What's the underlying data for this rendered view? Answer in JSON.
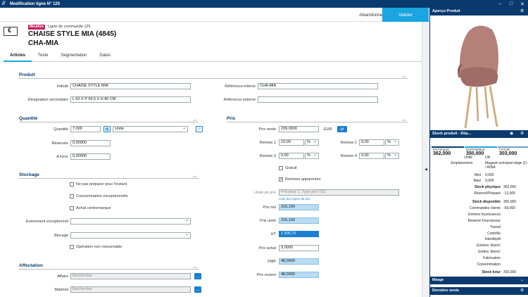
{
  "window": {
    "logo": "//",
    "title": "Modification ligne N° 125"
  },
  "toolbar": {
    "cancel": "Abandonner",
    "validate": "Valider"
  },
  "header": {
    "badge": "Meubles",
    "subtitle": "Ligne de commande 125",
    "name": "CHAISE STYLE MIA (4845)",
    "code": "CHA-MIA"
  },
  "tabs": [
    "Articles",
    "Texte",
    "Segmentation",
    "Dates"
  ],
  "produit": {
    "title": "Produit",
    "intitule_label": "Intitulé",
    "intitule": "CHAISE STYLE MIA",
    "designation_label": "Désignation secondaire",
    "designation": "L 62 X P 59,5 X H 86 CM",
    "ref_interne_label": "Référence interne",
    "ref_interne": "CHA-MIA",
    "ref_externe_label": "Référence externe",
    "ref_externe": ""
  },
  "quantite": {
    "title": "Quantité",
    "quantite_label": "Quantité",
    "quantite": "7,000",
    "unite": "Unité",
    "reservee_label": "Réservée",
    "reservee": "0,00000",
    "alivrer_label": "A livrer",
    "alivrer": "0,00000"
  },
  "stockage": {
    "title": "Stockage",
    "cb1": "Ne pas préparer pour l'instant",
    "cb2": "Consommation exceptionnelle",
    "cb3": "Achat contremarque",
    "evenement_label": "Evénement exceptionnel",
    "blocage_label": "Blocage",
    "cb4": "Opération non ristournable"
  },
  "affectation": {
    "title": "Affectation",
    "affaire_label": "Affaire",
    "affaire_ph": "Rechercher",
    "materiel_label": "Matériel",
    "materiel_ph": "Rechercher"
  },
  "prix": {
    "title": "Prix",
    "prix_vente_label": "Prix vente",
    "prix_vente": "239,0000",
    "devise": "EUR",
    "remise1_label": "Remise 1",
    "remise1": "10,00",
    "remise1_unit": "%",
    "remise2_label": "Remise 2",
    "remise2": "0,00",
    "remise2_unit": "%",
    "remise3_label": "Remise 3",
    "remise3": "0,00",
    "remise3_unit": "%",
    "remise4_label": "Remise 4",
    "remise4": "0,00",
    "remise4_unit": "%",
    "gratuit": "Gratuit",
    "remises_app": "Remises apparentes",
    "unite_prix_label": "Unité de prix",
    "unite_prix": "Prix pour 1 ,Type prix:TG1",
    "liste_link": "Liste des types de prix",
    "prix_net_label": "Prix net",
    "prix_net": "215,100",
    "prix_unite_label": "Prix unité",
    "prix_unite": "215,100",
    "ht_label": "HT",
    "ht": "1 505,70",
    "prix_achat_label": "Prix achat",
    "prix_achat": "9,0000",
    "pmp_label": "PMP",
    "pmp": "48,0000",
    "prix_revient_label": "Prix revient",
    "prix_revient": "48,0000"
  },
  "side": {
    "apercu": "Aperçu Produit",
    "stock_title": "Stock produit - Dép...",
    "boxes": [
      {
        "label": "PHYSIQUE",
        "value": "362,000"
      },
      {
        "label": "DISPONIBLE",
        "value": "350,000"
      },
      {
        "label": "FUTUR",
        "value": "303,000"
      }
    ],
    "unite_label": "Unité",
    "unite": "UN",
    "emplacement_label": "Emplacement",
    "emplacement": "Magasin principal siège (1) / A05A",
    "mini_label": "Mini",
    "mini": "0,000",
    "maxi_label": "Maxi",
    "maxi": "0,000",
    "rows": [
      {
        "label": "Stock physique",
        "value": "362,000",
        "bold": true
      },
      {
        "label": "Réservé/Préparé",
        "value": "-12,000"
      },
      {
        "label": "Stock disponible",
        "value": "350,000",
        "bold": true
      },
      {
        "label": "Commandes clients",
        "value": "-59,000"
      },
      {
        "label": "Entrées fournisseurs",
        "value": ""
      },
      {
        "label": "Réservé Fournisseur",
        "value": ""
      },
      {
        "label": "Transit",
        "value": ""
      },
      {
        "label": "Contrôle",
        "value": ""
      },
      {
        "label": "Interdépôt",
        "value": ""
      },
      {
        "label": "Entrées 'divers'",
        "value": ""
      },
      {
        "label": "Sorties 'divers'",
        "value": ""
      },
      {
        "label": "Fabrication",
        "value": ""
      },
      {
        "label": "Consommation",
        "value": ""
      },
      {
        "label": "Stock futur",
        "value": "303,000",
        "bold": true
      }
    ],
    "marge": "Marge",
    "derniere": "Dernière vente"
  }
}
